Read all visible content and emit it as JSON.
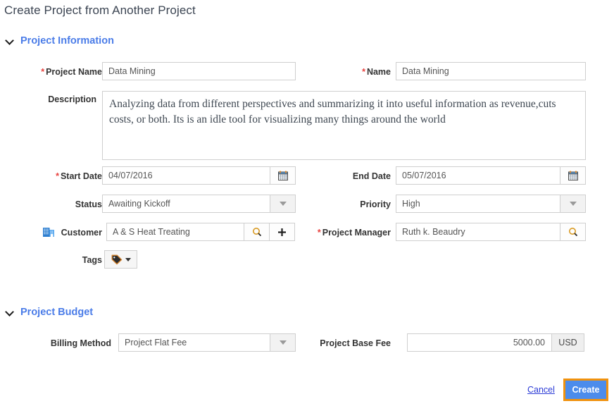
{
  "page": {
    "title": "Create Project from Another Project"
  },
  "sections": {
    "project_information": {
      "title": "Project Information",
      "chevron": "chevron-down-icon"
    },
    "project_budget": {
      "title": "Project Budget",
      "chevron": "chevron-down-icon"
    }
  },
  "fields": {
    "project_name": {
      "label": "Project Name",
      "required_marker": "*",
      "value": "Data Mining"
    },
    "name": {
      "label": "Name",
      "required_marker": "*",
      "value": "Data Mining"
    },
    "description": {
      "label": "Description",
      "value": "Analyzing data from different perspectives and summarizing it into useful information as revenue,cuts costs, or both. Its is an idle tool for visualizing many things around the world"
    },
    "start_date": {
      "label": "Start Date",
      "required_marker": "*",
      "value": "04/07/2016",
      "button_icon": "calendar-icon"
    },
    "end_date": {
      "label": "End Date",
      "value": "05/07/2016",
      "button_icon": "calendar-icon"
    },
    "status": {
      "label": "Status",
      "value": "Awaiting Kickoff",
      "button_icon": "chevron-down-icon"
    },
    "priority": {
      "label": "Priority",
      "value": "High",
      "button_icon": "chevron-down-icon"
    },
    "customer": {
      "label": "Customer",
      "prefix_icon": "building-icon",
      "value": "A & S Heat Treating",
      "search_icon": "search-icon",
      "add_icon": "plus-icon"
    },
    "project_manager": {
      "label": "Project Manager",
      "required_marker": "*",
      "value": "Ruth k. Beaudry",
      "search_icon": "search-icon"
    },
    "tags": {
      "label": "Tags",
      "button_icon": "tag-icon",
      "caret_icon": "caret-down-icon"
    },
    "billing_method": {
      "label": "Billing Method",
      "value": "Project Flat Fee",
      "button_icon": "chevron-down-icon"
    },
    "project_base_fee": {
      "label": "Project Base Fee",
      "value": "5000.00",
      "currency": "USD"
    }
  },
  "actions": {
    "cancel": "Cancel",
    "create": "Create"
  },
  "colors": {
    "section_heading": "#4a7ce8",
    "required_asterisk": "#e8423f",
    "link": "#2a3ad6",
    "primary_button_bg": "#4c8ceb",
    "primary_button_focus_ring": "#f0920e",
    "field_border": "#cfcfcf"
  }
}
